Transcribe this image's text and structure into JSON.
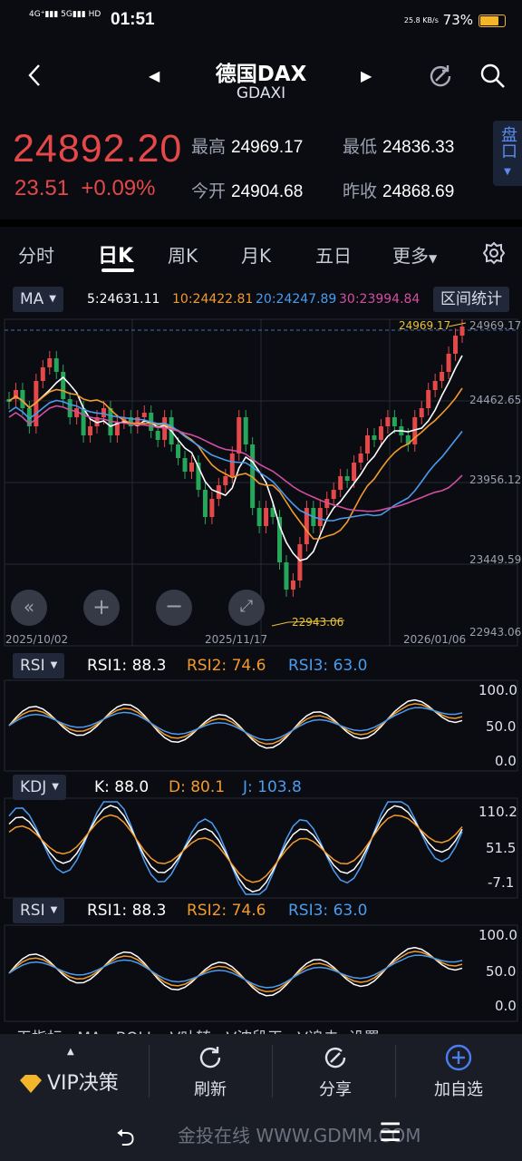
{
  "status": {
    "network": "4G⁺ 5G",
    "time": "01:51",
    "speed": "25.8 KB/s",
    "battery": "73%"
  },
  "header": {
    "title": "德国DAX",
    "code": "GDAXI"
  },
  "quote": {
    "price": "24892.20",
    "change": "23.51",
    "change_pct": "+0.09%",
    "high_label": "最高",
    "high": "24969.17",
    "low_label": "最低",
    "low": "24836.33",
    "open_label": "今开",
    "open": "24904.68",
    "prev_label": "昨收",
    "prev": "24868.69",
    "side_tab": "盘口"
  },
  "tabs": {
    "t1": "分时",
    "t2": "日K",
    "t3": "周K",
    "t4": "月K",
    "t5": "五日",
    "more": "更多"
  },
  "ma_bar": {
    "chip": "MA",
    "ma5": "5:24631.11",
    "ma10": "10:24422.81",
    "ma20": "20:24247.89",
    "ma30": "30:23994.84",
    "range_btn": "区间统计"
  },
  "price_axis": {
    "top": "24969.17",
    "l2": "24462.65",
    "l3": "23956.12",
    "l4": "23449.59",
    "bottom": "22943.06",
    "max_label": "24969.17",
    "min_label": "22943.06"
  },
  "dates": {
    "d1": "2025/10/02",
    "d2": "2025/11/17",
    "d3": "2026/01/06"
  },
  "rsi1": {
    "chip": "RSI",
    "r1": "RSI1: 88.3",
    "r2": "RSI2: 74.6",
    "r3": "RSI3: 63.0",
    "a1": "100.0",
    "a2": "50.0",
    "a3": "0.0"
  },
  "kdj": {
    "chip": "KDJ",
    "k": "K: 88.0",
    "d": "D: 80.1",
    "j": "J: 103.8",
    "a1": "110.2",
    "a2": "51.5",
    "a3": "-7.1"
  },
  "rsi2": {
    "chip": "RSI",
    "r1": "RSI1: 88.3",
    "r2": "RSI2: 74.6",
    "r3": "RSI3: 63.0",
    "a1": "100.0",
    "a2": "50.0",
    "a3": "0.0"
  },
  "indicator_tabs": "无指标   MA   BOLL   V叶转   V波段王   V追击  设置",
  "bottom": {
    "vip": "VIP决策",
    "refresh": "刷新",
    "share": "分享",
    "add": "加自选"
  },
  "watermark": "金投在线 WWW.GDMM.COM",
  "colors": {
    "up": "#e54848",
    "down": "#26a65b",
    "ma5": "#ffffff",
    "ma10": "#f39a2c",
    "ma20": "#4a9cf0",
    "ma30": "#d24fa0"
  }
}
